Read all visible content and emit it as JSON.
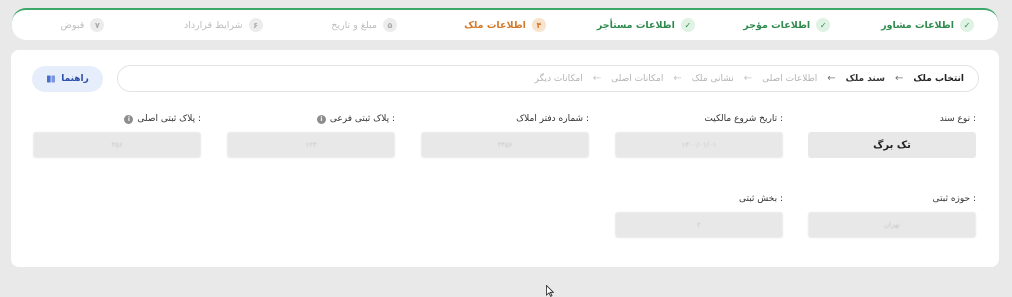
{
  "steps": [
    {
      "num": "✓",
      "label": "اطلاعات مشاور",
      "state": "done"
    },
    {
      "num": "✓",
      "label": "اطلاعات مؤجر",
      "state": "done"
    },
    {
      "num": "✓",
      "label": "اطلاعات مستأجر",
      "state": "done"
    },
    {
      "num": "۴",
      "label": "اطلاعات ملک",
      "state": "active"
    },
    {
      "num": "۵",
      "label": "مبلغ و تاریخ",
      "state": "todo"
    },
    {
      "num": "۶",
      "label": "شرایط قرارداد",
      "state": "todo"
    },
    {
      "num": "۷",
      "label": "قبوض",
      "state": "todo"
    }
  ],
  "breadcrumb": {
    "items": [
      "انتخاب ملک",
      "سند ملک",
      "اطلاعات اصلی",
      "نشانی ملک",
      "امکانات اصلی",
      "امکانات دیگر"
    ],
    "separator": "←"
  },
  "help_button": {
    "label": "راهنما",
    "icon": "book-icon"
  },
  "fields": {
    "doc_type": {
      "label": "نوع سند :",
      "value": "تک برگ"
    },
    "ownership_start": {
      "label": "تاریخ شروع مالکیت :",
      "value": "۱۴۰۰/۰۱/۰۱"
    },
    "registry_number": {
      "label": "شماره دفتر املاک :",
      "value": "۳۴۵۶"
    },
    "sub_plate": {
      "label": "پلاک ثبتی فرعی :",
      "value": "۱۲۳"
    },
    "main_plate": {
      "label": "پلاک ثبتی اصلی :",
      "value": "۴۵۶"
    },
    "registry_zone": {
      "label": "حوزه ثبتی :",
      "value": "تهران"
    },
    "registry_section": {
      "label": "بخش ثبتی :",
      "value": "۲"
    }
  },
  "colors": {
    "done": "#2f8a4e",
    "active": "#d27a2a",
    "todo": "#bdbdbd",
    "help_bg": "#e6edfb"
  }
}
